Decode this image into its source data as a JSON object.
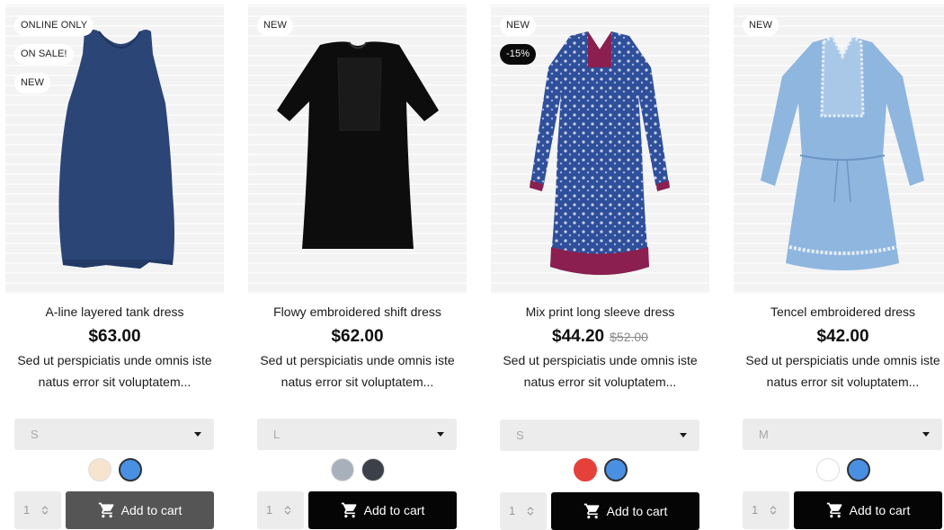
{
  "products": [
    {
      "title": "A-line layered tank dress",
      "price": "$63.00",
      "old_price": "",
      "description": "Sed ut perspiciatis unde omnis iste natus error sit voluptatem...",
      "badges": [
        "ONLINE ONLY",
        "ON SALE!",
        "NEW"
      ],
      "size_selected": "S",
      "swatches": [
        "#f6e4cf",
        "#4a90e2"
      ],
      "active_swatch": 1,
      "quantity": "1",
      "add_to_cart_label": "Add to cart",
      "image_icon": "navy-tank-dress-image"
    },
    {
      "title": "Flowy embroidered shift dress",
      "price": "$62.00",
      "old_price": "",
      "description": "Sed ut perspiciatis unde omnis iste natus error sit voluptatem...",
      "badges": [
        "NEW"
      ],
      "size_selected": "L",
      "swatches": [
        "#a8b0bc",
        "#3c4049"
      ],
      "active_swatch": -1,
      "quantity": "1",
      "add_to_cart_label": "Add to cart",
      "image_icon": "black-shift-dress-image"
    },
    {
      "title": "Mix print long sleeve dress",
      "price": "$44.20",
      "old_price": "$52.00",
      "description": "Sed ut perspiciatis unde omnis iste natus error sit voluptatem...",
      "badges": [
        "NEW",
        "-15%"
      ],
      "size_selected": "S",
      "swatches": [
        "#e5413a",
        "#4a90e2"
      ],
      "active_swatch": 1,
      "quantity": "1",
      "add_to_cart_label": "Add to cart",
      "image_icon": "print-long-sleeve-dress-image"
    },
    {
      "title": "Tencel embroidered dress",
      "price": "$42.00",
      "old_price": "",
      "description": "Sed ut perspiciatis unde omnis iste natus error sit voluptatem...",
      "badges": [
        "NEW"
      ],
      "size_selected": "M",
      "swatches": [
        "#ffffff",
        "#4a90e2"
      ],
      "active_swatch": 1,
      "quantity": "1",
      "add_to_cart_label": "Add to cart",
      "image_icon": "light-blue-embroidered-dress-image"
    }
  ],
  "colors": {
    "button_bg": "#050505",
    "button_hover_bg": "#555555",
    "field_bg": "#ececec",
    "badge_sale_bg": "#0a0a0a"
  },
  "icons": {
    "cart": "cart-icon",
    "select_caret": "chevron-down-icon",
    "qty_spinner": "spinner-icon"
  }
}
